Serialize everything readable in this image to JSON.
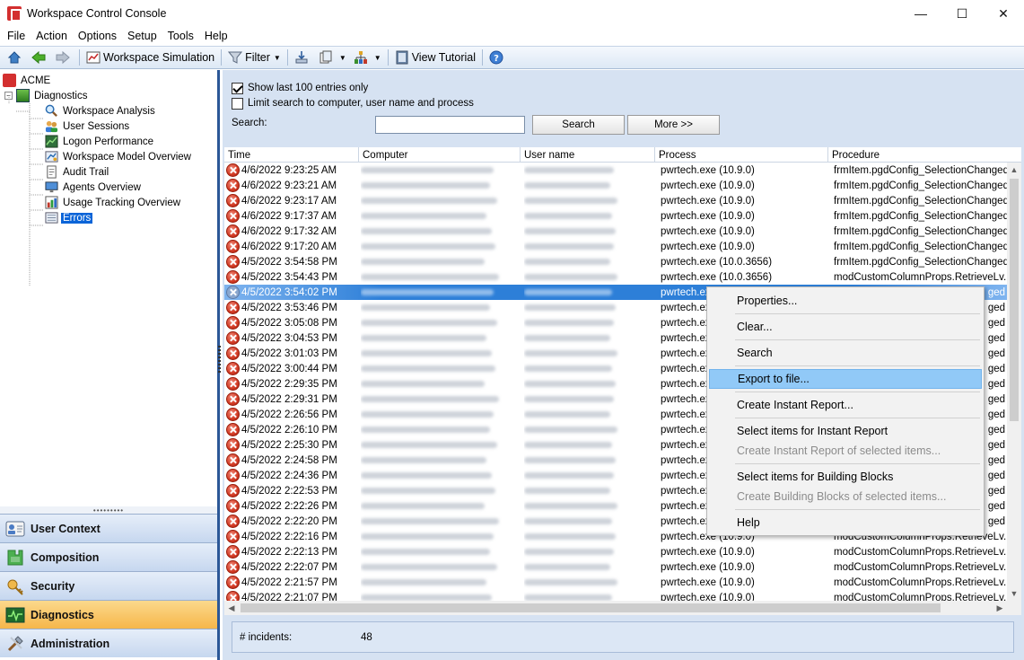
{
  "window": {
    "title": "Workspace Control Console",
    "minimize": "—",
    "maximize": "☐",
    "close": "✕"
  },
  "menu": [
    "File",
    "Action",
    "Options",
    "Setup",
    "Tools",
    "Help"
  ],
  "toolbar": {
    "workspace_simulation": "Workspace Simulation",
    "filter": "Filter",
    "view_tutorial": "View Tutorial"
  },
  "tree": {
    "root": "ACME",
    "diagnostics": "Diagnostics",
    "children": [
      "Workspace Analysis",
      "User Sessions",
      "Logon Performance",
      "Workspace Model Overview",
      "Audit Trail",
      "Agents Overview",
      "Usage Tracking Overview",
      "Errors"
    ],
    "selected": "Errors"
  },
  "nav": [
    "User Context",
    "Composition",
    "Security",
    "Diagnostics",
    "Administration"
  ],
  "nav_active": "Diagnostics",
  "filters": {
    "show_last": "Show last 100 entries only",
    "show_last_checked": true,
    "limit_search": "Limit search to computer, user name and process",
    "limit_search_checked": false,
    "search_label": "Search:",
    "search_value": "",
    "search_button": "Search",
    "more_button": "More >>"
  },
  "columns": [
    "Time",
    "Computer",
    "User name",
    "Process",
    "Procedure"
  ],
  "rows": [
    {
      "time": "4/6/2022 9:23:25 AM",
      "process": "pwrtech.exe (10.9.0)",
      "procedure": "frmItem.pgdConfig_SelectionChanged"
    },
    {
      "time": "4/6/2022 9:23:21 AM",
      "process": "pwrtech.exe (10.9.0)",
      "procedure": "frmItem.pgdConfig_SelectionChanged"
    },
    {
      "time": "4/6/2022 9:23:17 AM",
      "process": "pwrtech.exe (10.9.0)",
      "procedure": "frmItem.pgdConfig_SelectionChanged"
    },
    {
      "time": "4/6/2022 9:17:37 AM",
      "process": "pwrtech.exe (10.9.0)",
      "procedure": "frmItem.pgdConfig_SelectionChanged"
    },
    {
      "time": "4/6/2022 9:17:32 AM",
      "process": "pwrtech.exe (10.9.0)",
      "procedure": "frmItem.pgdConfig_SelectionChanged"
    },
    {
      "time": "4/6/2022 9:17:20 AM",
      "process": "pwrtech.exe (10.9.0)",
      "procedure": "frmItem.pgdConfig_SelectionChanged"
    },
    {
      "time": "4/5/2022 3:54:58 PM",
      "process": "pwrtech.exe (10.0.3656)",
      "procedure": "frmItem.pgdConfig_SelectionChanged"
    },
    {
      "time": "4/5/2022 3:54:43 PM",
      "process": "pwrtech.exe (10.0.3656)",
      "procedure": "modCustomColumnProps.RetrieveLv..."
    },
    {
      "time": "4/5/2022 3:54:02 PM",
      "process": "pwrtech.exe",
      "procedure": "ged",
      "selected": true
    },
    {
      "time": "4/5/2022 3:53:46 PM",
      "process": "pwrtech.ex",
      "procedure": "ged"
    },
    {
      "time": "4/5/2022 3:05:08 PM",
      "process": "pwrtech.ex",
      "procedure": "ged"
    },
    {
      "time": "4/5/2022 3:04:53 PM",
      "process": "pwrtech.ex",
      "procedure": "ged"
    },
    {
      "time": "4/5/2022 3:01:03 PM",
      "process": "pwrtech.ex",
      "procedure": "ged"
    },
    {
      "time": "4/5/2022 3:00:44 PM",
      "process": "pwrtech.ex",
      "procedure": "ged"
    },
    {
      "time": "4/5/2022 2:29:35 PM",
      "process": "pwrtech.ex",
      "procedure": "ged"
    },
    {
      "time": "4/5/2022 2:29:31 PM",
      "process": "pwrtech.ex",
      "procedure": "ged"
    },
    {
      "time": "4/5/2022 2:26:56 PM",
      "process": "pwrtech.ex",
      "procedure": "ged"
    },
    {
      "time": "4/5/2022 2:26:10 PM",
      "process": "pwrtech.ex",
      "procedure": "ged"
    },
    {
      "time": "4/5/2022 2:25:30 PM",
      "process": "pwrtech.ex",
      "procedure": "ged"
    },
    {
      "time": "4/5/2022 2:24:58 PM",
      "process": "pwrtech.ex",
      "procedure": "ged"
    },
    {
      "time": "4/5/2022 2:24:36 PM",
      "process": "pwrtech.ex",
      "procedure": "ged"
    },
    {
      "time": "4/5/2022 2:22:53 PM",
      "process": "pwrtech.ex",
      "procedure": "ged"
    },
    {
      "time": "4/5/2022 2:22:26 PM",
      "process": "pwrtech.ex",
      "procedure": "ged"
    },
    {
      "time": "4/5/2022 2:22:20 PM",
      "process": "pwrtech.ex",
      "procedure": "ged"
    },
    {
      "time": "4/5/2022 2:22:16 PM",
      "process": "pwrtech.exe (10.9.0)",
      "procedure": "modCustomColumnProps.RetrieveLv..."
    },
    {
      "time": "4/5/2022 2:22:13 PM",
      "process": "pwrtech.exe (10.9.0)",
      "procedure": "modCustomColumnProps.RetrieveLv..."
    },
    {
      "time": "4/5/2022 2:22:07 PM",
      "process": "pwrtech.exe (10.9.0)",
      "procedure": "modCustomColumnProps.RetrieveLv..."
    },
    {
      "time": "4/5/2022 2:21:57 PM",
      "process": "pwrtech.exe (10.9.0)",
      "procedure": "modCustomColumnProps.RetrieveLv..."
    },
    {
      "time": "4/5/2022 2:21:07 PM",
      "process": "pwrtech.exe (10.9.0)",
      "procedure": "modCustomColumnProps.RetrieveLv..."
    }
  ],
  "context_menu": [
    {
      "label": "Properties...",
      "enabled": true
    },
    {
      "sep": true
    },
    {
      "label": "Clear...",
      "enabled": true
    },
    {
      "sep": true
    },
    {
      "label": "Search",
      "enabled": true
    },
    {
      "sep": true
    },
    {
      "label": "Export to file...",
      "enabled": true,
      "highlighted": true
    },
    {
      "sep": true
    },
    {
      "label": "Create Instant Report...",
      "enabled": true
    },
    {
      "sep": true
    },
    {
      "label": "Select items for Instant Report",
      "enabled": true
    },
    {
      "label": "Create Instant Report of selected items...",
      "enabled": false
    },
    {
      "sep": true
    },
    {
      "label": "Select items for Building Blocks",
      "enabled": true
    },
    {
      "label": "Create Building Blocks of selected items...",
      "enabled": false
    },
    {
      "sep": true
    },
    {
      "label": "Help",
      "enabled": true
    }
  ],
  "status": {
    "label": "# incidents:",
    "value": "48"
  }
}
